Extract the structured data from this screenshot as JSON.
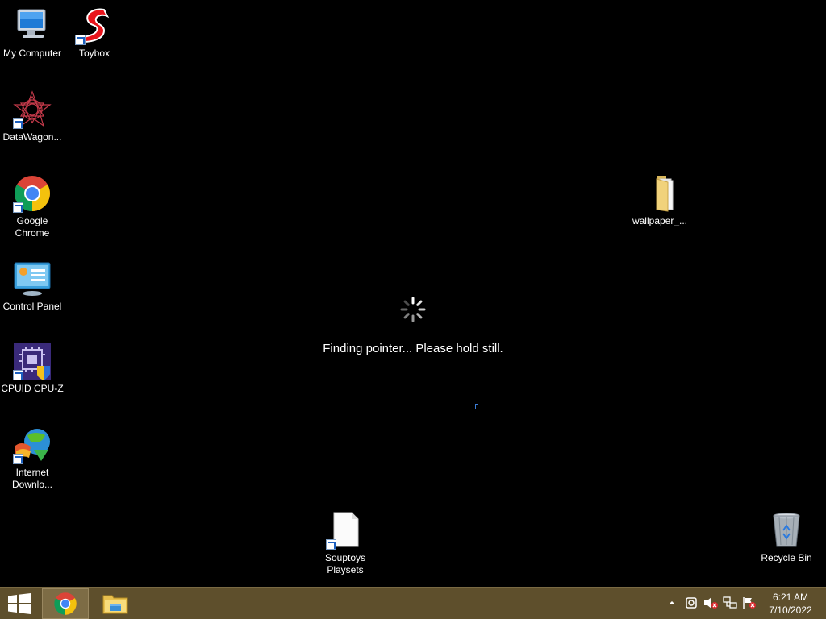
{
  "desktop": {
    "icons": [
      {
        "label": "My Computer",
        "icon": "my-computer-icon"
      },
      {
        "label": "Toybox",
        "icon": "toybox-icon"
      },
      {
        "label": "DataWagon...",
        "icon": "datawagon-icon"
      },
      {
        "label": "Google Chrome",
        "icon": "google-chrome-icon"
      },
      {
        "label": "Control Panel",
        "icon": "control-panel-icon"
      },
      {
        "label": "CPUID CPU-Z",
        "icon": "cpu-z-icon"
      },
      {
        "label": "Internet Downlo...",
        "icon": "internet-download-icon"
      },
      {
        "label": "wallpaper_...",
        "icon": "folder-icon"
      },
      {
        "label": "Souptoys Playsets",
        "icon": "document-icon"
      },
      {
        "label": "Recycle Bin",
        "icon": "recycle-bin-icon"
      }
    ]
  },
  "overlay": {
    "message": "Finding pointer... Please hold still.",
    "spinner_icon": "loading-spinner-icon"
  },
  "taskbar": {
    "start_icon": "windows-logo-icon",
    "pinned": [
      {
        "name": "Google Chrome",
        "icon": "chrome-icon",
        "active": true
      },
      {
        "name": "File Explorer",
        "icon": "file-explorer-icon",
        "active": false
      }
    ],
    "tray": {
      "icons": [
        "show-hidden-icons-chevron-icon",
        "app-tray-icon",
        "speaker-muted-icon",
        "network-icon",
        "flag-alert-icon"
      ],
      "time": "6:21 AM",
      "date": "7/10/2022"
    }
  },
  "colors": {
    "taskbar": "#5e4f2c",
    "desktop": "#000000"
  }
}
